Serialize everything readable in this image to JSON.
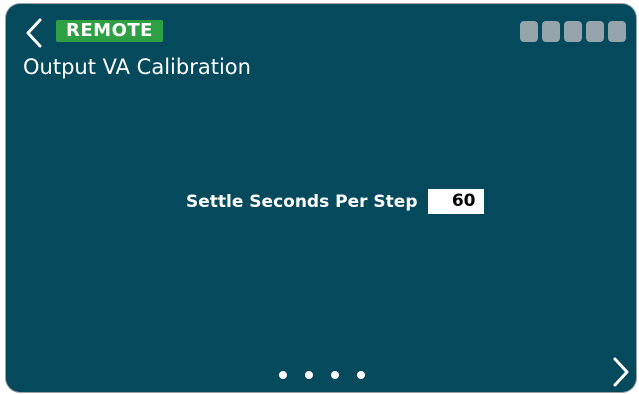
{
  "header": {
    "back_icon": "chevron-left-icon",
    "mode_badge": "REMOTE",
    "signal_icon": "signal-strength-icon",
    "signal_bars": 5,
    "title": "Output VA Calibration"
  },
  "setting": {
    "label": "Settle Seconds Per Step",
    "value": "60"
  },
  "pagination": {
    "page_count": 4,
    "current_page": 1
  },
  "footer": {
    "next_icon": "chevron-right-icon"
  },
  "colors": {
    "screen_background": "#044a5c",
    "badge_background": "#2f9f43",
    "signal_bar": "#93a5aa",
    "text": "#ffffff",
    "value_field_background": "#ffffff"
  }
}
